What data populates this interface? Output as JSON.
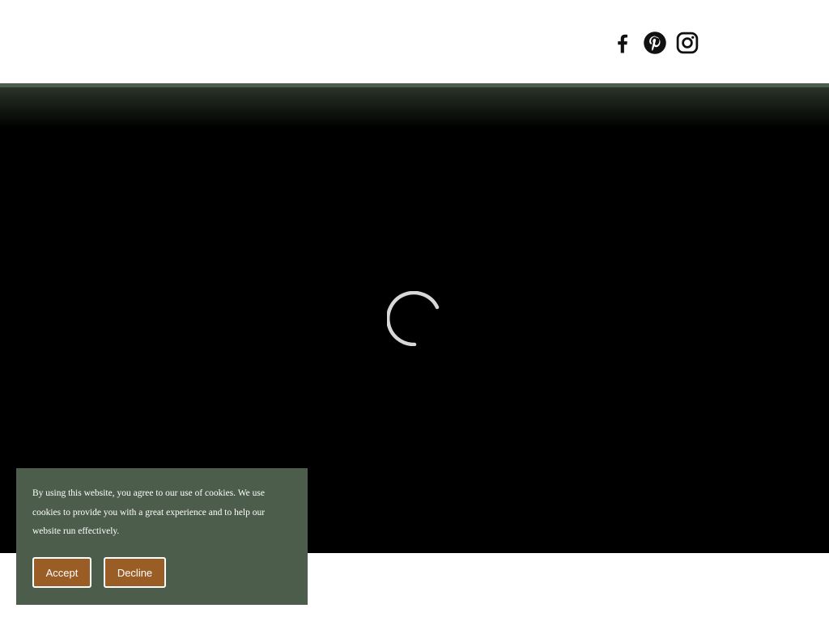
{
  "header": {
    "social_links": [
      {
        "icon": "facebook-icon"
      },
      {
        "icon": "pinterest-icon"
      },
      {
        "icon": "instagram-icon"
      }
    ]
  },
  "hero": {
    "background": "#000000",
    "loading_indicator": "spinner"
  },
  "cookie_banner": {
    "message": "By using this website, you agree to our use of cookies. We use cookies to provide you with a great experience and to help our website run effectively.",
    "accept_label": "Accept",
    "decline_label": "Decline",
    "background": "#4c5d4b",
    "button_color": "#9b5d26"
  }
}
